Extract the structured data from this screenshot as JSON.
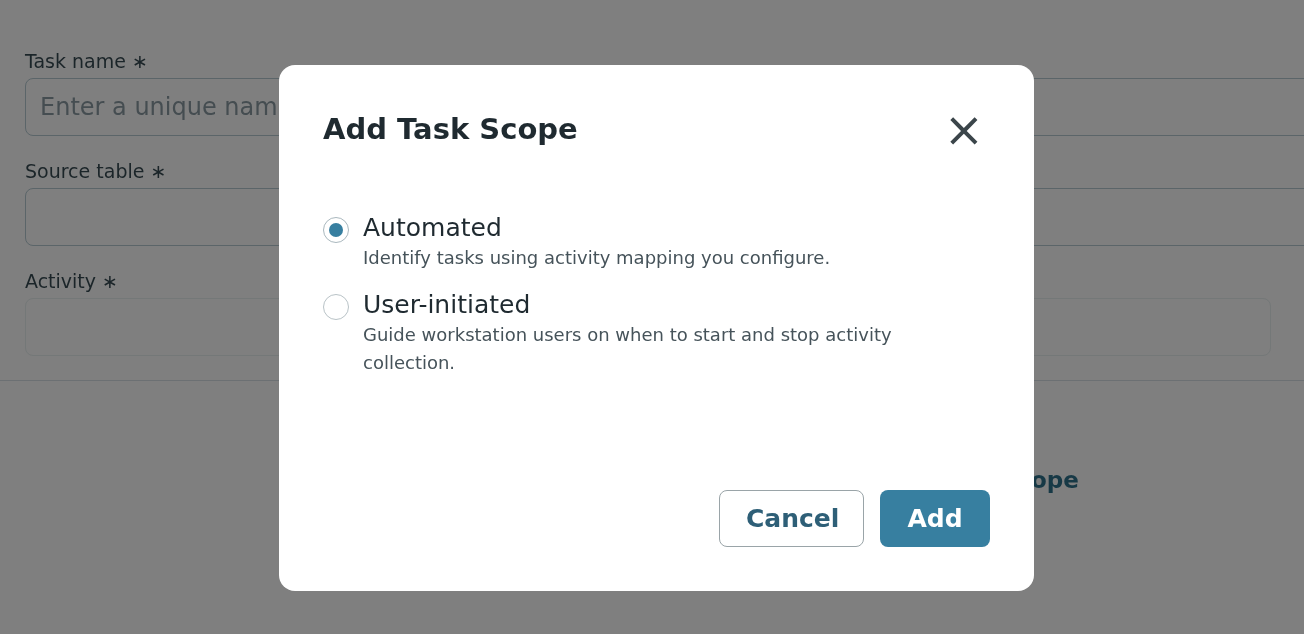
{
  "form": {
    "fields": [
      {
        "label": "Task name",
        "required": "∗",
        "placeholder": "Enter a unique nam"
      },
      {
        "label": "Source table",
        "required": "∗"
      },
      {
        "label": "Activity",
        "required": "∗"
      }
    ],
    "link": "ope"
  },
  "dialog": {
    "title": "Add Task Scope",
    "close": "×",
    "options": [
      {
        "label": "Automated",
        "description": "Identify tasks using activity mapping you configure.",
        "selected": true
      },
      {
        "label": "User-initiated",
        "description": "Guide workstation users on when to start and stop activity collection.",
        "selected": false
      }
    ],
    "buttons": [
      {
        "label": "Cancel",
        "kind": "secondary"
      },
      {
        "label": "Add",
        "kind": "primary"
      }
    ]
  }
}
